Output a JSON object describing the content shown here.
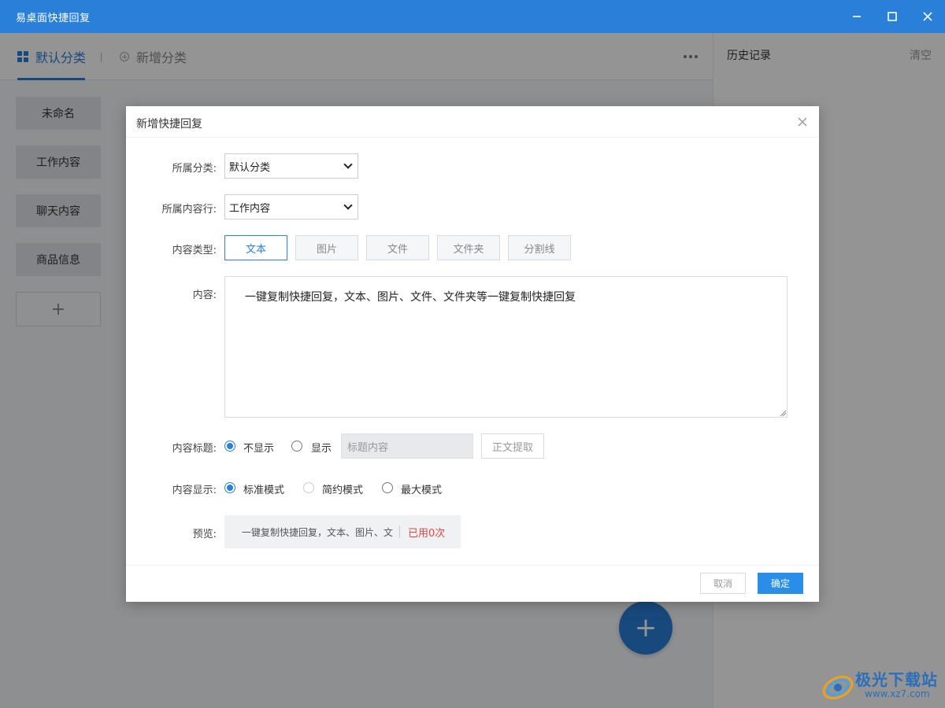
{
  "window": {
    "title": "易桌面快捷回复"
  },
  "tabs": {
    "default_label": "默认分类",
    "add_label": "新增分类"
  },
  "categories": [
    {
      "label": "未命名"
    },
    {
      "label": "工作内容"
    },
    {
      "label": "聊天内容"
    },
    {
      "label": "商品信息"
    }
  ],
  "category_add_symbol": "+",
  "fab_symbol": "+",
  "history": {
    "title": "历史记录",
    "clear_label": "清空"
  },
  "dialog": {
    "title": "新增快捷回复",
    "category_label": "所属分类:",
    "category_value": "默认分类",
    "row_label": "所属内容行:",
    "row_value": "工作内容",
    "type_label": "内容类型:",
    "types": [
      "文本",
      "图片",
      "文件",
      "文件夹",
      "分割线"
    ],
    "active_type": "文本",
    "content_label": "内容:",
    "content_value": "一键复制快捷回复，文本、图片、文件、文件夹等一键复制快捷回复",
    "title_label": "内容标题:",
    "title_options": [
      "不显示",
      "显示"
    ],
    "title_selected": "不显示",
    "title_placeholder": "标题内容",
    "extract_label": "正文提取",
    "display_label": "内容显示:",
    "display_options": [
      "标准模式",
      "简约模式",
      "最大模式"
    ],
    "display_selected": "标准模式",
    "preview_label": "预览:",
    "preview_text": "一键复制快捷回复，文本、图片、文",
    "preview_count": "已用0次",
    "cancel_label": "取消",
    "ok_label": "确定"
  },
  "watermark": {
    "text": "极光下载站",
    "url": "www.xz7.com"
  },
  "colors": {
    "brand_blue": "#2a7fd8",
    "ok_button": "#2a8ee8",
    "used_count_red": "#e64545"
  }
}
